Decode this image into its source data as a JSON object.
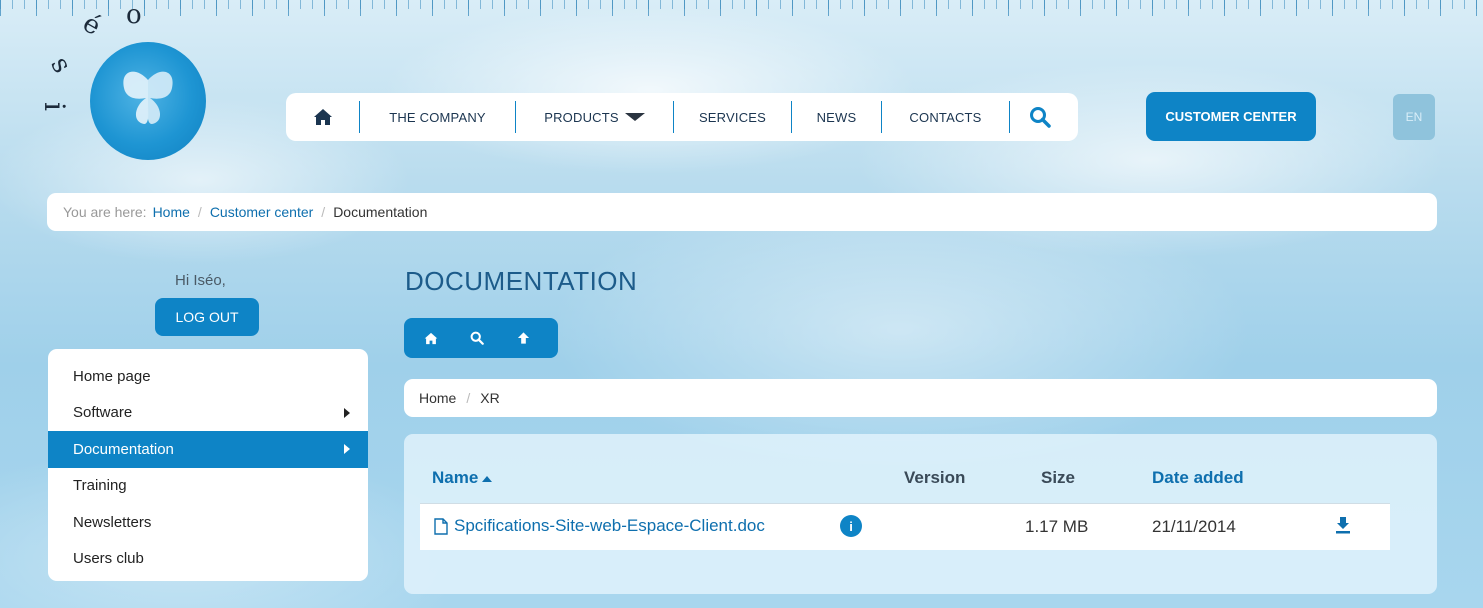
{
  "logo": {
    "letters": [
      "i",
      "s",
      "é",
      "o"
    ],
    "icon": "butterfly-logo"
  },
  "nav": {
    "home_icon": "home-icon",
    "items": [
      "THE COMPANY",
      "PRODUCTS",
      "SERVICES",
      "NEWS",
      "CONTACTS"
    ],
    "search_icon": "search-icon"
  },
  "customer_center_label": "CUSTOMER CENTER",
  "language_label": "EN",
  "breadcrumb": {
    "prefix": "You are here:",
    "items": [
      "Home",
      "Customer center",
      "Documentation"
    ]
  },
  "user": {
    "greeting": "Hi Iséo,",
    "logout_label": "LOG OUT"
  },
  "sidebar": {
    "items": [
      {
        "label": "Home page"
      },
      {
        "label": "Software"
      },
      {
        "label": "Documentation"
      },
      {
        "label": "Training"
      },
      {
        "label": "Newsletters"
      },
      {
        "label": "Users club"
      }
    ]
  },
  "main": {
    "title": "DOCUMENTATION",
    "toolbar": [
      "home-icon",
      "search-icon",
      "arrow-up-icon"
    ],
    "path": [
      "Home",
      "XR"
    ],
    "table": {
      "columns": [
        "Name",
        "Version",
        "Size",
        "Date added"
      ],
      "rows": [
        {
          "name": "Spcifications-Site-web-Espace-Client.doc",
          "version": "",
          "size": "1.17 MB",
          "date": "21/11/2014"
        }
      ]
    }
  },
  "colors": {
    "accent": "#0e84c6",
    "link": "#0e6fae",
    "title": "#1c5b8a"
  }
}
